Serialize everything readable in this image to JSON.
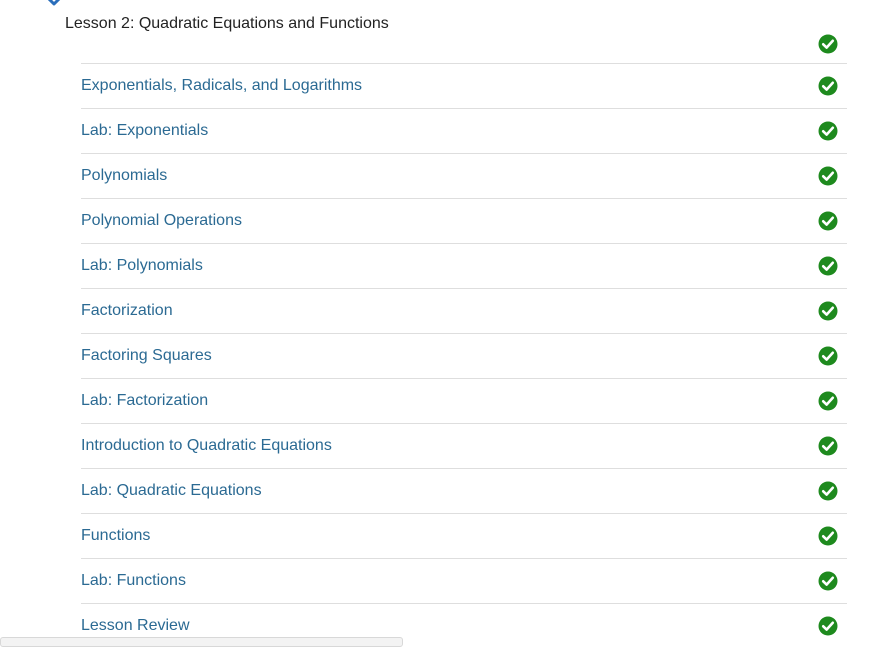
{
  "lesson": {
    "title": "Lesson 2: Quadratic Equations and Functions",
    "expand_icon": "chevron-down-icon",
    "status_icon": "check-circle-icon"
  },
  "items": [
    {
      "label": "Exponentials, Radicals, and Logarithms",
      "status_icon": "check-circle-icon"
    },
    {
      "label": "Lab: Exponentials",
      "status_icon": "check-circle-icon"
    },
    {
      "label": "Polynomials",
      "status_icon": "check-circle-icon"
    },
    {
      "label": "Polynomial Operations",
      "status_icon": "check-circle-icon"
    },
    {
      "label": "Lab: Polynomials",
      "status_icon": "check-circle-icon"
    },
    {
      "label": "Factorization",
      "status_icon": "check-circle-icon"
    },
    {
      "label": "Factoring Squares",
      "status_icon": "check-circle-icon"
    },
    {
      "label": "Lab: Factorization",
      "status_icon": "check-circle-icon"
    },
    {
      "label": "Introduction to Quadratic Equations",
      "status_icon": "check-circle-icon"
    },
    {
      "label": "Lab: Quadratic Equations",
      "status_icon": "check-circle-icon"
    },
    {
      "label": "Functions",
      "status_icon": "check-circle-icon"
    },
    {
      "label": "Lab: Functions",
      "status_icon": "check-circle-icon"
    },
    {
      "label": "Lesson Review",
      "status_icon": "check-circle-icon"
    }
  ],
  "colors": {
    "link": "#2b6a93",
    "complete": "#1e8a1e",
    "accent": "#2a6ebb",
    "divider": "#dedede"
  }
}
